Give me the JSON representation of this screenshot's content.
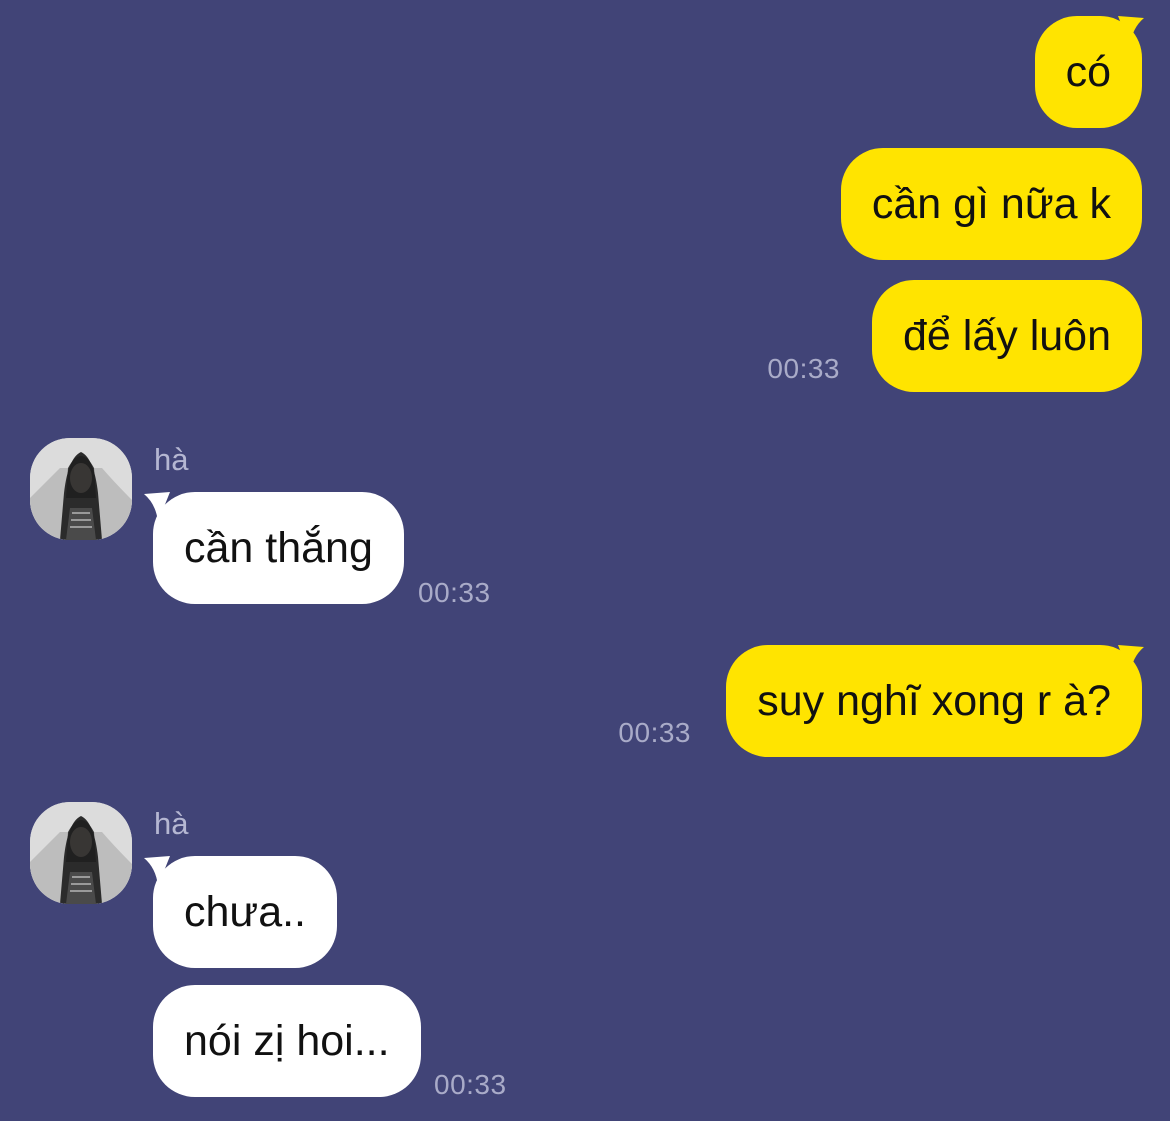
{
  "colors": {
    "background": "#414477",
    "outgoing_bubble": "#FFE400",
    "incoming_bubble": "#FFFFFF",
    "timestamp": "#A9ABC8"
  },
  "messages": [
    {
      "direction": "outgoing",
      "text": "có"
    },
    {
      "direction": "outgoing",
      "text": "cần gì nữa k"
    },
    {
      "direction": "outgoing",
      "text": "để lấy luôn",
      "time": "00:33"
    },
    {
      "direction": "incoming",
      "sender": "hà",
      "text": "cần thắng",
      "time": "00:33"
    },
    {
      "direction": "outgoing",
      "text": "suy nghĩ xong r à?",
      "time": "00:33"
    },
    {
      "direction": "incoming",
      "sender": "hà",
      "text": "chưa.."
    },
    {
      "direction": "incoming",
      "text": "nói zị hoi...",
      "time": "00:33"
    }
  ],
  "icons": {
    "avatar": "profile-photo"
  }
}
